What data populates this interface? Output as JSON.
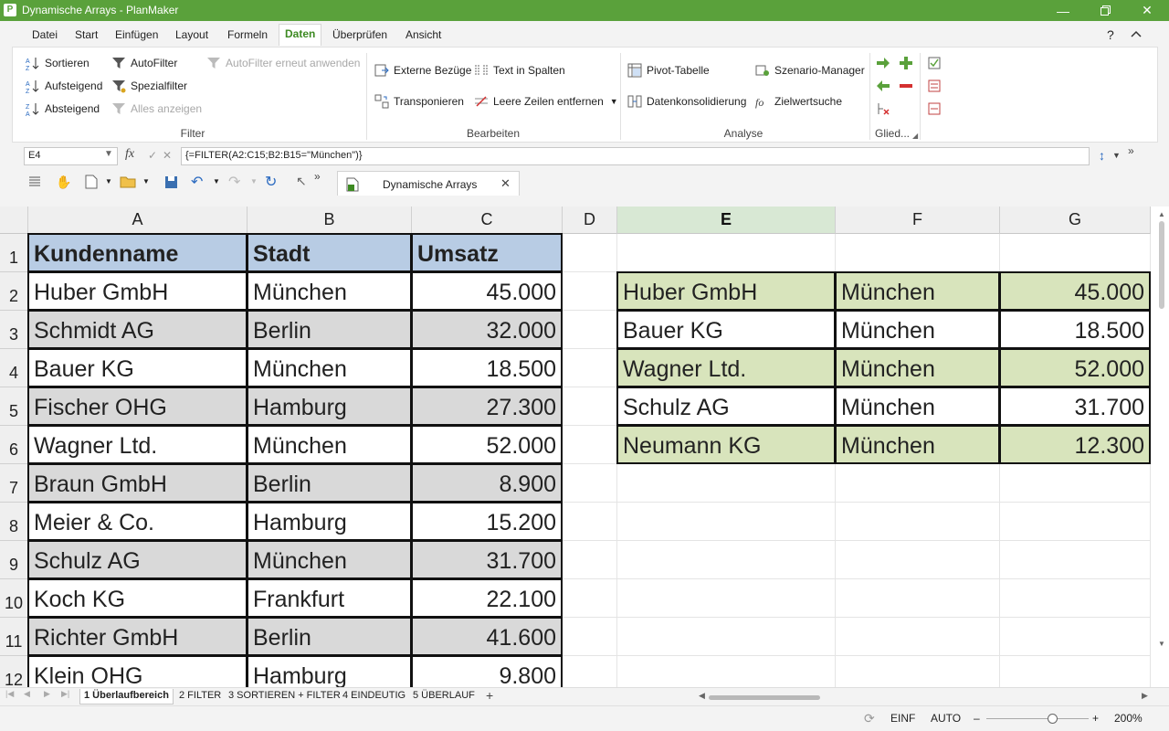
{
  "window": {
    "title": "Dynamische Arrays - PlanMaker",
    "app_icon": "P"
  },
  "menu": [
    "Datei",
    "Start",
    "Einfügen",
    "Layout",
    "Formeln",
    "Daten",
    "Überprüfen",
    "Ansicht"
  ],
  "menu_active": "Daten",
  "ribbon": {
    "filter": {
      "sort": "Sortieren",
      "asc": "Aufsteigend",
      "desc": "Absteigend",
      "autofilter": "AutoFilter",
      "special": "Spezialfilter",
      "show_all": "Alles anzeigen",
      "reapply": "AutoFilter erneut anwenden",
      "label": "Filter"
    },
    "edit": {
      "external": "Externe Bezüge",
      "transpose": "Transponieren",
      "text_to_cols": "Text in Spalten",
      "remove_empty": "Leere Zeilen entfernen",
      "label": "Bearbeiten"
    },
    "analysis": {
      "pivot": "Pivot-Tabelle",
      "consolidate": "Datenkonsolidierung",
      "scenario": "Szenario-Manager",
      "goal_seek": "Zielwertsuche",
      "label": "Analyse"
    },
    "outline": {
      "label": "Glied..."
    }
  },
  "formula_bar": {
    "cell_ref": "E4",
    "formula": "{=FILTER(A2:C15;B2:B15=\"München\")}"
  },
  "document_tab": "Dynamische Arrays",
  "columns": [
    "A",
    "B",
    "C",
    "D",
    "E",
    "F",
    "G"
  ],
  "rows": [
    "1",
    "2",
    "3",
    "4",
    "5",
    "6",
    "7",
    "8",
    "9",
    "10",
    "11",
    "12"
  ],
  "selected_column": "E",
  "source_table": {
    "headers": [
      "Kundenname",
      "Stadt",
      "Umsatz"
    ],
    "rows": [
      [
        "Huber GmbH",
        "München",
        "45.000"
      ],
      [
        "Schmidt AG",
        "Berlin",
        "32.000"
      ],
      [
        "Bauer KG",
        "München",
        "18.500"
      ],
      [
        "Fischer OHG",
        "Hamburg",
        "27.300"
      ],
      [
        "Wagner Ltd.",
        "München",
        "52.000"
      ],
      [
        "Braun GmbH",
        "Berlin",
        "8.900"
      ],
      [
        "Meier & Co.",
        "Hamburg",
        "15.200"
      ],
      [
        "Schulz AG",
        "München",
        "31.700"
      ],
      [
        "Koch KG",
        "Frankfurt",
        "22.100"
      ],
      [
        "Richter GmbH",
        "Berlin",
        "41.600"
      ],
      [
        "Klein OHG",
        "Hamburg",
        "9.800"
      ]
    ]
  },
  "filter_result": [
    [
      "Huber GmbH",
      "München",
      "45.000"
    ],
    [
      "Bauer KG",
      "München",
      "18.500"
    ],
    [
      "Wagner Ltd.",
      "München",
      "52.000"
    ],
    [
      "Schulz AG",
      "München",
      "31.700"
    ],
    [
      "Neumann KG",
      "München",
      "12.300"
    ]
  ],
  "sheet_tabs": [
    "1 Überlaufbereich",
    "2 FILTER",
    "3 SORTIEREN + FILTER",
    "4 EINDEUTIG",
    "5 ÜBERLAUF"
  ],
  "active_sheet_tab": "1 Überlaufbereich",
  "status": {
    "mode1": "EINF",
    "mode2": "AUTO",
    "zoom": "200%"
  },
  "colors": {
    "accent": "#5aa13b",
    "header_fill": "#b8cce4",
    "stripe_fill": "#d9d9d9",
    "result_fill": "#d8e4bc",
    "selection": "#d8e8d4"
  }
}
